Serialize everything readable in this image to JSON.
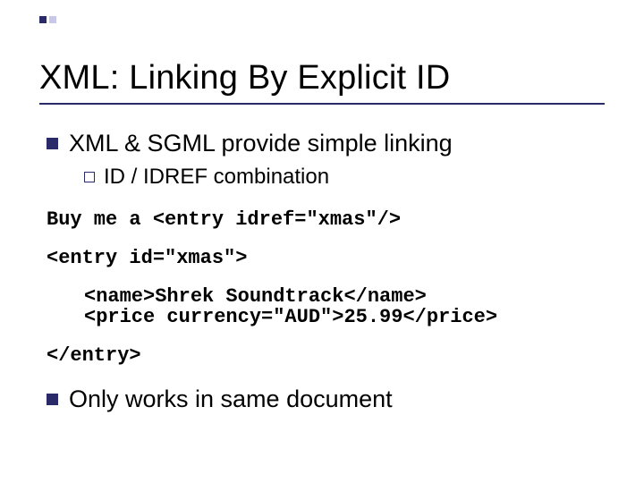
{
  "title": "XML: Linking By Explicit ID",
  "bullet1": "XML & SGML provide simple linking",
  "sub1_prefix": "ID",
  "sub1_rest": " / IDREF combination",
  "code1": "Buy me a <entry idref=\"xmas\"/>",
  "code2": "<entry id=\"xmas\">",
  "code3": "<name>Shrek Soundtrack</name>",
  "code4": "<price currency=\"AUD\">25.99</price>",
  "code5": "</entry>",
  "bullet2": "Only works in same document"
}
